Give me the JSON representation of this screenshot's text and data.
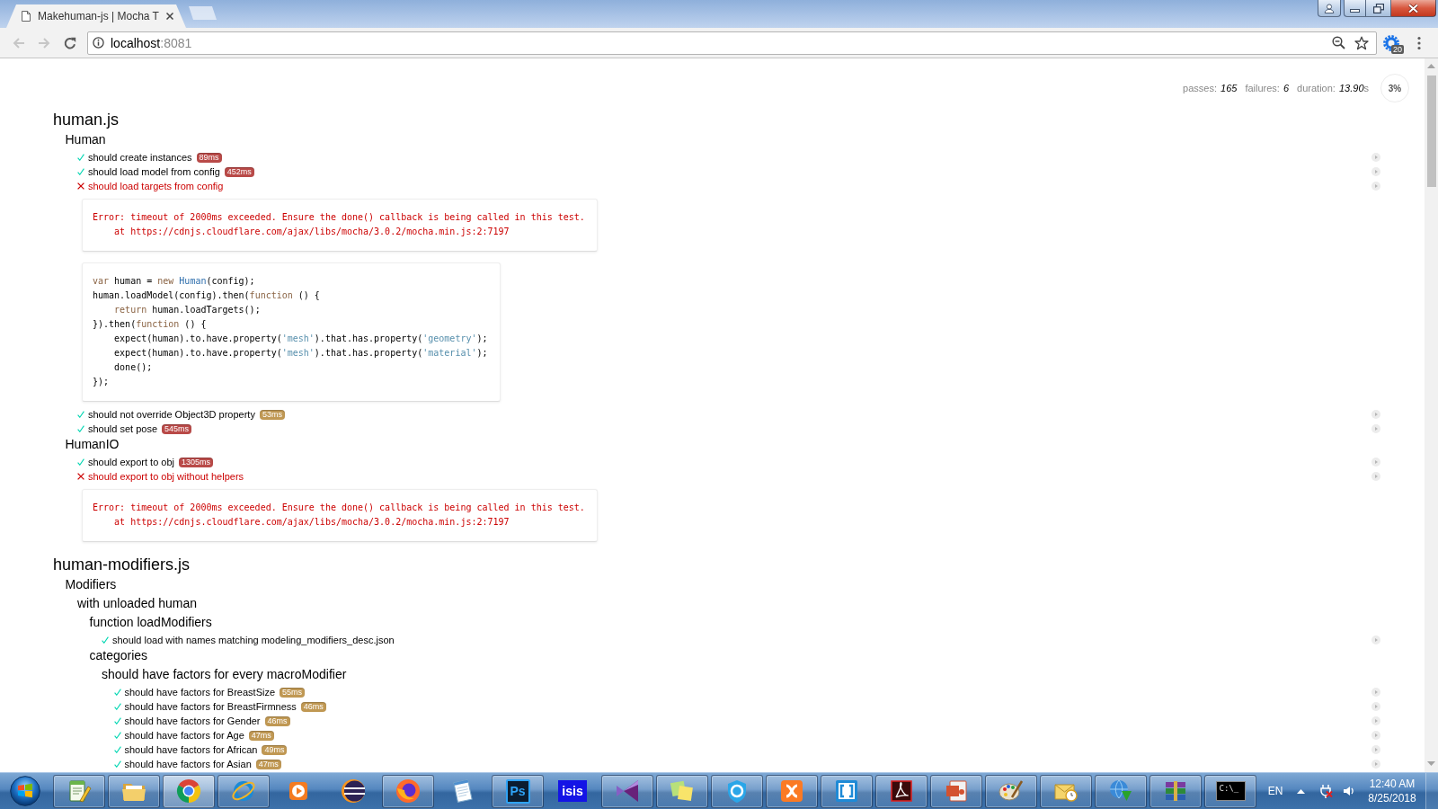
{
  "browser": {
    "tab_title": "Makehuman-js | Mocha T",
    "nav": {
      "back_disabled": true,
      "forward_disabled": true
    },
    "address": {
      "host": "localhost",
      "port": ":8081"
    },
    "extension_badge": "20"
  },
  "stats": {
    "items": [
      {
        "label": "passes:",
        "value": "165"
      },
      {
        "label": "failures:",
        "value": "6"
      },
      {
        "label": "duration:",
        "value": "13.90",
        "unit": "s"
      }
    ],
    "progress": "3%"
  },
  "report": [
    {
      "kind": "suite",
      "title": "human.js",
      "children": [
        {
          "kind": "suite",
          "title": "Human",
          "children": [
            {
              "kind": "test",
              "title": "should create instances",
              "passed": true,
              "duration": "89ms",
              "color": "#b94a48"
            },
            {
              "kind": "test",
              "title": "should load model from config",
              "passed": true,
              "duration": "452ms",
              "color": "#b94a48"
            },
            {
              "kind": "test",
              "title": "should load targets from config",
              "passed": false,
              "error": "Error: timeout of 2000ms exceeded. Ensure the done() callback is being called in this test.\n    at https://cdnjs.cloudflare.com/ajax/libs/mocha/3.0.2/mocha.min.js:2:7197",
              "code": [
                [
                  {
                    "text": "var",
                    "kind": "keyword"
                  },
                  {
                    "text": " human = ",
                    "kind": "plain"
                  },
                  {
                    "text": "new ",
                    "kind": "keyword"
                  },
                  {
                    "text": "Human",
                    "kind": "init"
                  },
                  {
                    "text": "(config);",
                    "kind": "plain"
                  }
                ],
                [
                  {
                    "text": "human.loadModel(config).then(",
                    "kind": "plain"
                  },
                  {
                    "text": "function",
                    "kind": "keyword"
                  },
                  {
                    "text": " () {",
                    "kind": "plain"
                  }
                ],
                [
                  {
                    "text": "    return",
                    "kind": "keyword"
                  },
                  {
                    "text": " human.loadTargets();",
                    "kind": "plain"
                  }
                ],
                [
                  {
                    "text": "}).then(",
                    "kind": "plain"
                  },
                  {
                    "text": "function",
                    "kind": "keyword"
                  },
                  {
                    "text": " () {",
                    "kind": "plain"
                  }
                ],
                [
                  {
                    "text": "    expect(human).to.have.property(",
                    "kind": "plain"
                  },
                  {
                    "text": "'mesh'",
                    "kind": "string"
                  },
                  {
                    "text": ").that.has.property(",
                    "kind": "plain"
                  },
                  {
                    "text": "'geometry'",
                    "kind": "string"
                  },
                  {
                    "text": ");",
                    "kind": "plain"
                  }
                ],
                [
                  {
                    "text": "    expect(human).to.have.property(",
                    "kind": "plain"
                  },
                  {
                    "text": "'mesh'",
                    "kind": "string"
                  },
                  {
                    "text": ").that.has.property(",
                    "kind": "plain"
                  },
                  {
                    "text": "'material'",
                    "kind": "string"
                  },
                  {
                    "text": ");",
                    "kind": "plain"
                  }
                ],
                [
                  {
                    "text": "    done();",
                    "kind": "plain"
                  }
                ],
                [
                  {
                    "text": "});",
                    "kind": "plain"
                  }
                ]
              ]
            },
            {
              "kind": "test",
              "title": "should not override Object3D property",
              "passed": true,
              "duration": "53ms",
              "color": "#c09853"
            },
            {
              "kind": "test",
              "title": "should set pose",
              "passed": true,
              "duration": "545ms",
              "color": "#b94a48"
            }
          ]
        },
        {
          "kind": "suite",
          "title": "HumanIO",
          "children": [
            {
              "kind": "test",
              "title": "should export to obj",
              "passed": true,
              "duration": "1305ms",
              "color": "#b94a48"
            },
            {
              "kind": "test",
              "title": "should export to obj without helpers",
              "passed": false,
              "error": "Error: timeout of 2000ms exceeded. Ensure the done() callback is being called in this test.\n    at https://cdnjs.cloudflare.com/ajax/libs/mocha/3.0.2/mocha.min.js:2:7197"
            }
          ]
        }
      ]
    },
    {
      "kind": "suite",
      "title": "human-modifiers.js",
      "children": [
        {
          "kind": "suite",
          "title": "Modifiers",
          "children": [
            {
              "kind": "suite",
              "title": "with unloaded human",
              "children": [
                {
                  "kind": "suite",
                  "title": "function loadModifiers",
                  "children": [
                    {
                      "kind": "test",
                      "title": "should load with names matching modeling_modifiers_desc.json",
                      "passed": true
                    }
                  ]
                },
                {
                  "kind": "suite",
                  "title": "categories",
                  "children": [
                    {
                      "kind": "suite",
                      "title": "should have factors for every macroModifier",
                      "children": [
                        {
                          "kind": "test",
                          "title": "should have factors for BreastSize",
                          "passed": true,
                          "duration": "55ms",
                          "color": "#c09853"
                        },
                        {
                          "kind": "test",
                          "title": "should have factors for BreastFirmness",
                          "passed": true,
                          "duration": "46ms",
                          "color": "#c09853"
                        },
                        {
                          "kind": "test",
                          "title": "should have factors for Gender",
                          "passed": true,
                          "duration": "46ms",
                          "color": "#c09853"
                        },
                        {
                          "kind": "test",
                          "title": "should have factors for Age",
                          "passed": true,
                          "duration": "47ms",
                          "color": "#c09853"
                        },
                        {
                          "kind": "test",
                          "title": "should have factors for African",
                          "passed": true,
                          "duration": "49ms",
                          "color": "#c09853"
                        },
                        {
                          "kind": "test",
                          "title": "should have factors for Asian",
                          "passed": true,
                          "duration": "47ms",
                          "color": "#c09853"
                        }
                      ]
                    }
                  ]
                }
              ]
            }
          ]
        }
      ]
    }
  ],
  "taskbar": {
    "apps": [
      {
        "running": true,
        "selected": false
      },
      {
        "running": true,
        "selected": false
      },
      {
        "running": true,
        "selected": true
      },
      {
        "running": true,
        "selected": false
      },
      {
        "running": false,
        "selected": false
      },
      {
        "running": false,
        "selected": false
      },
      {
        "running": true,
        "selected": false
      },
      {
        "running": false,
        "selected": false
      },
      {
        "running": true,
        "selected": false,
        "glyph": "Ps"
      },
      {
        "running": false,
        "selected": false,
        "glyph": "isis"
      },
      {
        "running": true,
        "selected": false
      },
      {
        "running": true,
        "selected": false
      },
      {
        "running": true,
        "selected": false
      },
      {
        "running": true,
        "selected": false
      },
      {
        "running": true,
        "selected": false
      },
      {
        "running": true,
        "selected": false
      },
      {
        "running": true,
        "selected": false
      },
      {
        "running": true,
        "selected": false
      },
      {
        "running": true,
        "selected": false
      },
      {
        "running": true,
        "selected": false
      },
      {
        "running": true,
        "selected": false
      },
      {
        "running": true,
        "selected": false,
        "glyph": "C:\\_"
      }
    ],
    "language": "EN",
    "time": "12:40 AM",
    "date": "8/25/2018"
  }
}
